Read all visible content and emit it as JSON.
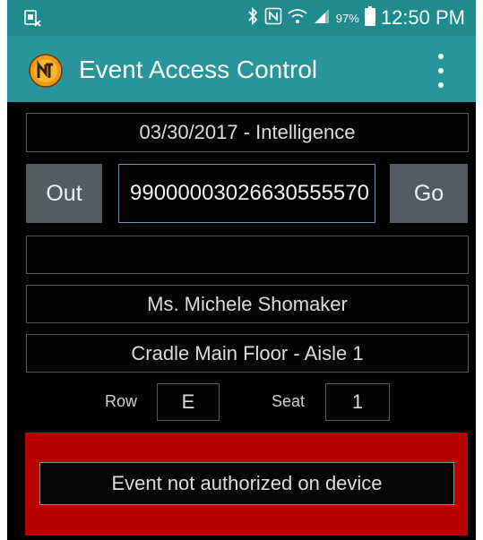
{
  "status_bar": {
    "battery_percent": "97%",
    "time": "12:50 PM",
    "icons": [
      "no-sim-icon",
      "bluetooth-icon",
      "nfc-icon",
      "wifi-icon",
      "signal-icon",
      "battery-icon"
    ]
  },
  "app_bar": {
    "title": "Event Access Control",
    "logo_icon": "app-logo-icon",
    "menu_icon": "overflow-menu-icon"
  },
  "event": {
    "date_name": "03/30/2017 - Intelligence"
  },
  "scan": {
    "out_label": "Out",
    "barcode_value": "99000003026630555570",
    "go_label": "Go"
  },
  "message_line": "",
  "patron": {
    "name": "Ms. Michele Shomaker",
    "section": "Cradle Main Floor - Aisle 1",
    "row_label": "Row",
    "row_value": "E",
    "seat_label": "Seat",
    "seat_value": "1"
  },
  "alert": {
    "message": "Event not authorized on device",
    "color": "#b80000"
  },
  "colors": {
    "status_bar": "#1e8a8e",
    "app_bar": "#28949b",
    "button": "#515d62"
  }
}
